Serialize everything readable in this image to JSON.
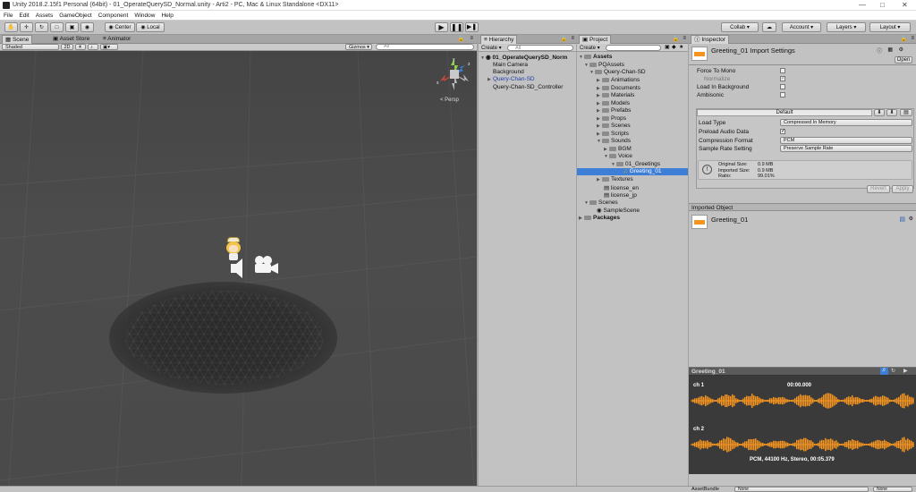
{
  "window": {
    "title": "Unity 2018.2.15f1 Personal (64bit) - 01_OperateQuerySD_Normal.unity - Arti2 - PC, Mac & Linux Standalone <DX11>"
  },
  "menu": [
    "File",
    "Edit",
    "Assets",
    "GameObject",
    "Component",
    "Window",
    "Help"
  ],
  "toolbar": {
    "center": "Center",
    "local": "Local",
    "collab": "Collab ▾",
    "account": "Account",
    "layers": "Layers",
    "layout": "Layout"
  },
  "scene": {
    "tabs": [
      "Scene",
      "Asset Store",
      "Animator"
    ],
    "shading": "Shaded",
    "mode_2d": "2D",
    "gizmos": "Gizmos ▾",
    "search_placeholder": "All",
    "persp": "Persp"
  },
  "hierarchy": {
    "tab": "Hierarchy",
    "create": "Create ▾",
    "search_placeholder": "All",
    "scene_name": "01_OperateQuerySD_Norm",
    "items": [
      "Main Camera",
      "Background",
      "Query-Chan-SD",
      "Query-Chan-SD_Controller"
    ]
  },
  "project": {
    "tab": "Project",
    "create": "Create ▾",
    "tree": [
      "Assets",
      "PQAssets",
      "Query-Chan-SD",
      "Animations",
      "Documents",
      "Materials",
      "Models",
      "Prefabs",
      "Props",
      "Scenes",
      "Scripts",
      "Sounds",
      "BGM",
      "Voice",
      "01_Greetings",
      "Greeting_01",
      "Textures",
      "license_en",
      "license_jp",
      "Scenes",
      "SampleScene",
      "Packages"
    ]
  },
  "inspector": {
    "tab": "Inspector",
    "title": "Greeting_01 Import Settings",
    "open": "Open",
    "force_to_mono": "Force To Mono",
    "normalize": "Normalize",
    "load_in_background": "Load In Background",
    "ambisonic": "Ambisonic",
    "platform_default": "Default",
    "load_type_label": "Load Type",
    "load_type_value": "Compressed In Memory",
    "preload_label": "Preload Audio Data",
    "compression_label": "Compression Format",
    "compression_value": "PCM",
    "sample_rate_label": "Sample Rate Setting",
    "sample_rate_value": "Preserve Sample Rate",
    "original_size_label": "Original Size:",
    "original_size": "0.9 MB",
    "imported_size_label": "Imported Size:",
    "imported_size": "0.9 MB",
    "ratio_label": "Ratio:",
    "ratio": "99.01%",
    "revert": "Revert",
    "apply": "Apply",
    "imported_object": "Imported Object",
    "object_name": "Greeting_01"
  },
  "preview": {
    "name": "Greeting_01",
    "time": "00:00.000",
    "ch1": "ch 1",
    "ch2": "ch 2",
    "info": "PCM, 44100 Hz, Stereo, 00:05.379"
  },
  "footer": {
    "asset_bundle": "AssetBundle",
    "none1": "None",
    "none2": "None"
  },
  "colors": {
    "selection": "#3d7ed6",
    "waveform": "#f5951f"
  }
}
